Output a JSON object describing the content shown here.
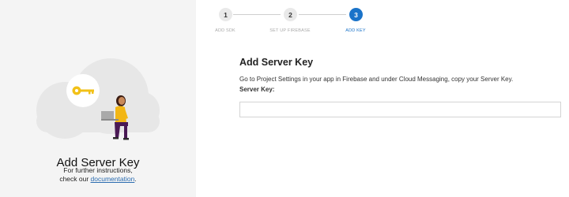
{
  "stepper": {
    "steps": [
      {
        "number": "1",
        "label": "ADD SDK"
      },
      {
        "number": "2",
        "label": "SET UP FIREBASE"
      },
      {
        "number": "3",
        "label": "ADD KEY"
      }
    ],
    "active_step": 3,
    "colors": {
      "active": "#1a73c9",
      "inactive": "#e9e9e9",
      "label_inactive": "#a9a9a9"
    }
  },
  "left_panel": {
    "title": "Add Server Key",
    "subtitle_line1": "For further instructions,",
    "subtitle_prefix": "check our ",
    "link_text": "documentation",
    "subtitle_suffix": ".",
    "illustration": {
      "icons": [
        "cloud-icon",
        "key-icon",
        "person-with-laptop-illustration"
      ],
      "colors": {
        "cloud": "#e7e7e7",
        "key_circle": "#ffffff",
        "key": "#f2c118",
        "shirt": "#f2b615",
        "pants": "#4a1a55"
      }
    }
  },
  "main": {
    "title": "Add Server Key",
    "description": "Go to Project Settings in your app in Firebase and under Cloud Messaging, copy your Server Key.",
    "field_label": "Server Key:",
    "server_key_value": ""
  }
}
